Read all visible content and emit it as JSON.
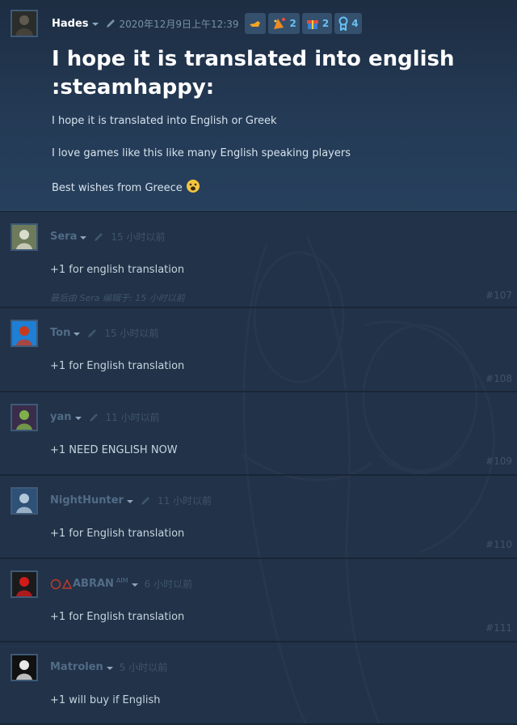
{
  "original_post": {
    "author": "Hades",
    "date": "2020年12月9日上午12:39",
    "awards": [
      {
        "icon": "thumb-award-icon",
        "count": ""
      },
      {
        "icon": "party-award-icon",
        "count": "2"
      },
      {
        "icon": "gift-award-icon",
        "count": "2"
      },
      {
        "icon": "medal-award-icon",
        "count": "4"
      }
    ],
    "title": "I hope it is translated into english :steamhappy:",
    "body": [
      "I hope it is translated into English or Greek",
      "I love games like this like many English speaking players",
      "Best wishes from Greece"
    ],
    "emoticon": "steamhappy-emoticon"
  },
  "comments": [
    {
      "author": "Sera",
      "time": "15 小时以前",
      "text": "+1 for english translation",
      "edit_note": "最后由 Sera 编辑于: 15 小时以前",
      "number": "#107",
      "has_edit_icon": true,
      "colors": [
        "#6d7b5a",
        "#d9dccc"
      ]
    },
    {
      "author": "Ton",
      "time": "15 小时以前",
      "text": "+1 for English translation",
      "number": "#108",
      "has_edit_icon": true,
      "colors": [
        "#1e7fd4",
        "#c73a1e"
      ]
    },
    {
      "author": "yan",
      "time": "11 小时以前",
      "text": "+1 NEED ENGLISH NOW",
      "number": "#109",
      "has_edit_icon": true,
      "colors": [
        "#3a2d4a",
        "#7fb04a"
      ]
    },
    {
      "author": "NightHunter",
      "time": "11 小时以前",
      "text": "+1 for English translation",
      "number": "#110",
      "has_edit_icon": true,
      "colors": [
        "#2f5077",
        "#b2c8d8"
      ]
    },
    {
      "author": "ABRAN",
      "author_sup": "AIM",
      "time": "6 小时以前",
      "text": "+1 for English translation",
      "number": "#111",
      "has_edit_icon": false,
      "colors": [
        "#1b1b1b",
        "#d11b1b"
      ]
    },
    {
      "author": "Matrolen",
      "time": "5 小时以前",
      "text": "+1 will buy if English",
      "number": "",
      "has_edit_icon": false,
      "colors": [
        "#111111",
        "#e8e8e8"
      ]
    }
  ],
  "colors": {
    "background": "#243449",
    "accent": "#66c0f4",
    "author_muted": "#516c87"
  }
}
